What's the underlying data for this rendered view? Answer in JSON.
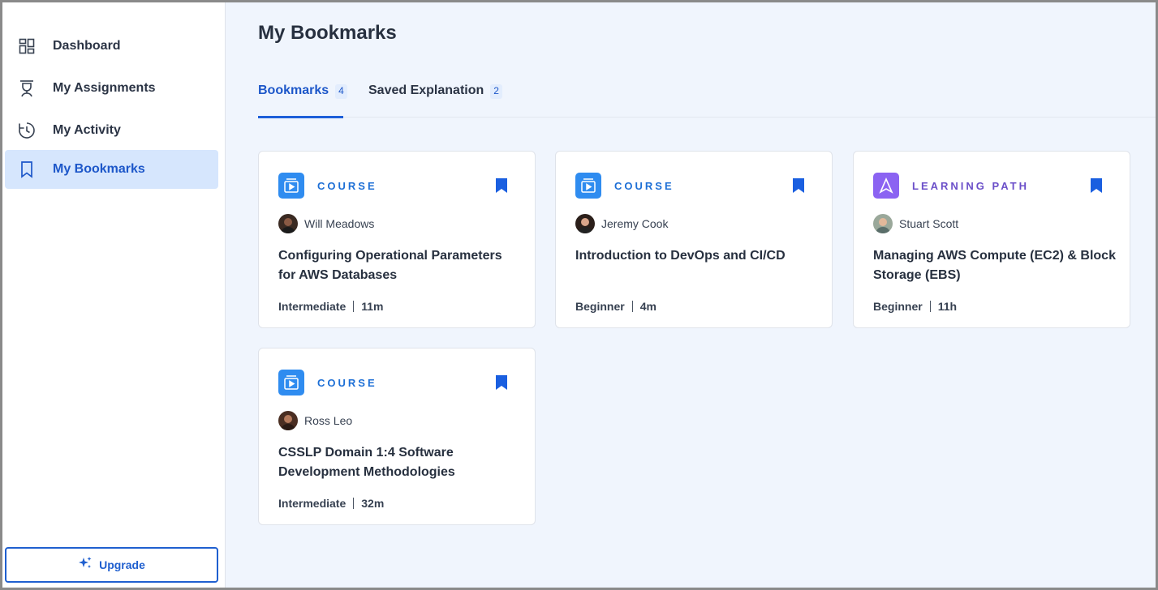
{
  "sidebar": {
    "items": [
      {
        "label": "Dashboard",
        "icon": "dashboard-grid-icon"
      },
      {
        "label": "My Assignments",
        "icon": "assignment-icon"
      },
      {
        "label": "My Activity",
        "icon": "history-clock-icon"
      },
      {
        "label": "My Bookmarks",
        "icon": "bookmark-outline-icon",
        "active": true
      }
    ],
    "upgrade_label": "Upgrade"
  },
  "main": {
    "title": "My Bookmarks",
    "tabs": [
      {
        "label": "Bookmarks",
        "count": "4",
        "active": true
      },
      {
        "label": "Saved Explanation",
        "count": "2"
      }
    ],
    "cards": [
      {
        "type": "COURSE",
        "author": "Will Meadows",
        "title": "Configuring Operational Parameters for AWS Databases",
        "level": "Intermediate",
        "duration": "11m"
      },
      {
        "type": "COURSE",
        "author": "Jeremy Cook",
        "title": "Introduction to DevOps and CI/CD",
        "level": "Beginner",
        "duration": "4m"
      },
      {
        "type": "LEARNING PATH",
        "author": "Stuart Scott",
        "title": "Managing AWS Compute (EC2) & Block Storage (EBS)",
        "level": "Beginner",
        "duration": "11h"
      },
      {
        "type": "COURSE",
        "author": "Ross Leo",
        "title": "CSSLP Domain 1:4 Software Development Methodologies",
        "level": "Intermediate",
        "duration": "32m"
      }
    ]
  },
  "colors": {
    "accent": "#1d57c9",
    "course_icon_bg": "#2f8cf0",
    "learning_path_icon_bg": "#8b63f2",
    "learning_path_label": "#6b4fc9",
    "active_nav_bg": "#d6e6fd",
    "bookmark_fill": "#1a5fe0"
  }
}
